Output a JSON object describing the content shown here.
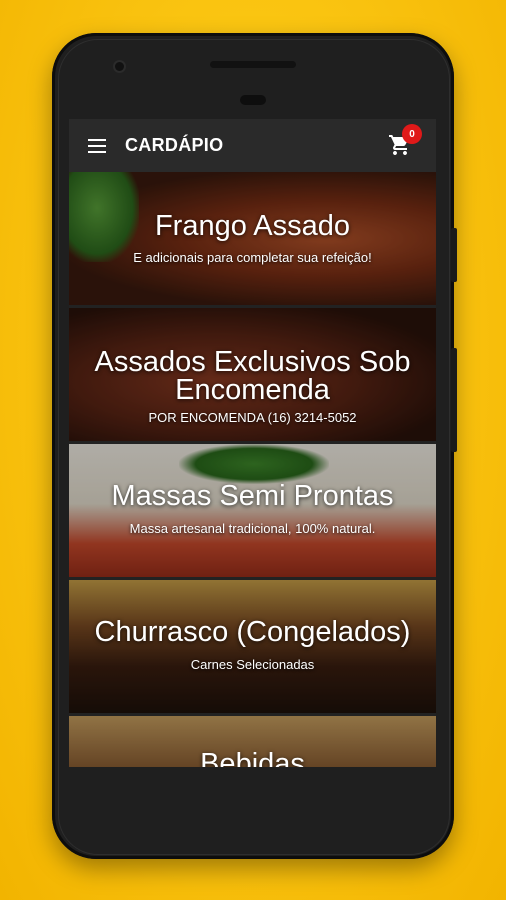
{
  "appbar": {
    "title": "CARDÁPIO",
    "cart_count": "0",
    "menu_icon": "hamburger-menu-icon",
    "cart_icon": "shopping-cart-icon"
  },
  "colors": {
    "background": "#f9c20f",
    "appbar": "#2a2a2a",
    "badge": "#e01919"
  },
  "categories": [
    {
      "title": "Frango Assado",
      "subtitle": "E adicionais para completar sua refeição!"
    },
    {
      "title": "Assados Exclusivos Sob Encomenda",
      "subtitle": "POR ENCOMENDA (16) 3214-5052"
    },
    {
      "title": "Massas Semi Prontas",
      "subtitle": "Massa artesanal tradicional, 100% natural."
    },
    {
      "title": "Churrasco (Congelados)",
      "subtitle": "Carnes Selecionadas"
    },
    {
      "title": "Bebidas",
      "subtitle": ""
    }
  ]
}
